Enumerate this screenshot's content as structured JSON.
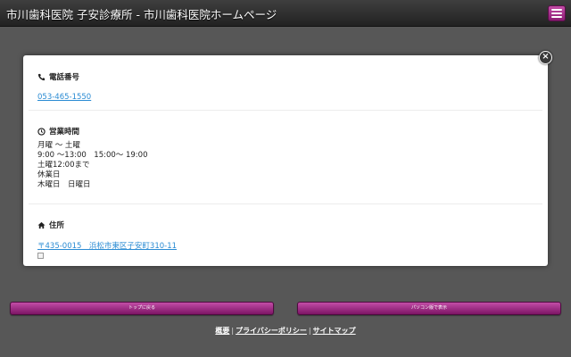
{
  "header": {
    "title": "市川歯科医院 子安診療所 - 市川歯科医院ホームページ",
    "menu_icon": "hamburger-menu-icon"
  },
  "close_icon": "close-icon",
  "phone": {
    "icon": "phone-icon",
    "heading": "電話番号",
    "number": "053-465-1550"
  },
  "hours": {
    "icon": "clock-icon",
    "heading": "営業時間",
    "lines": [
      "月曜 〜 土曜",
      "9:00 〜13:00　15:00〜 19:00",
      "土曜12:00まで",
      "休業日",
      "木曜日　日曜日"
    ]
  },
  "address": {
    "icon": "home-icon",
    "heading": "住所",
    "text": "〒435-0015　浜松市東区子安町310-11"
  },
  "buttons": {
    "top": "トップに戻る",
    "pc": "パソコン版で表示"
  },
  "footer": {
    "links": [
      "概要",
      "プライバシーポリシー",
      "サイトマップ"
    ],
    "separator": "|"
  },
  "colors": {
    "accent": "#a3288a",
    "link": "#2a8bd3",
    "background": "#575757"
  }
}
